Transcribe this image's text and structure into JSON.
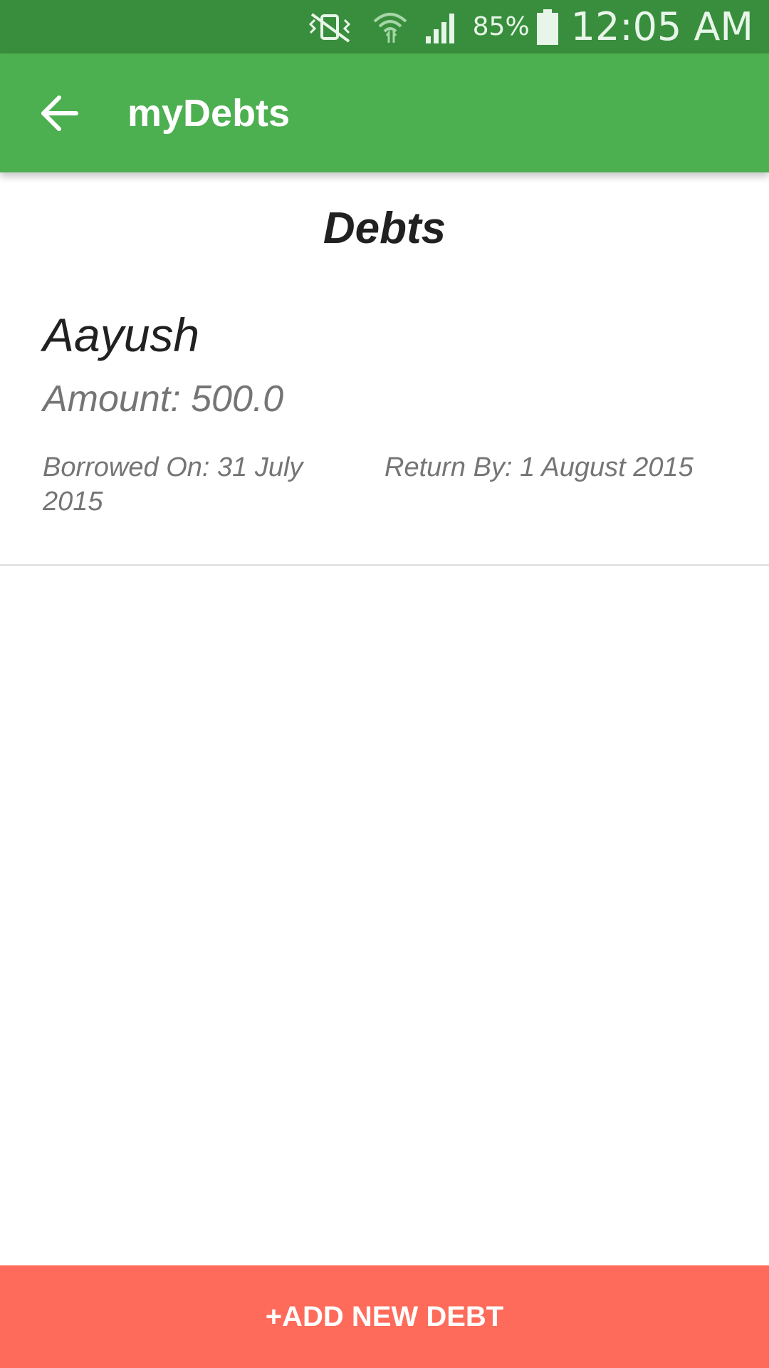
{
  "status_bar": {
    "icons": [
      "vibrate-mute-icon",
      "wifi-icon",
      "signal-icon",
      "battery-icon"
    ],
    "battery_percent": "85%",
    "time": "12:05 AM",
    "color": "#388e3c"
  },
  "app_bar": {
    "back_icon": "arrow-back-icon",
    "title": "myDebts",
    "color": "#4caf50"
  },
  "main": {
    "section_title": "Debts",
    "debts": [
      {
        "name": "Aayush",
        "amount": "Amount: 500.0",
        "borrowed_on": "Borrowed On: 31 July 2015",
        "return_by": "Return By: 1 August 2015"
      }
    ]
  },
  "footer": {
    "add_button_label": "+ADD NEW DEBT",
    "color": "#ff6b5a"
  }
}
